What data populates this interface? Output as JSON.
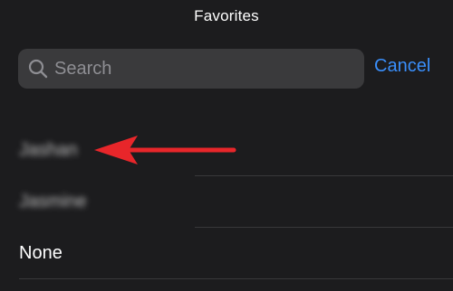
{
  "header": {
    "title": "Favorites"
  },
  "search": {
    "placeholder": "Search",
    "value": "",
    "cancel_label": "Cancel"
  },
  "list": {
    "items": [
      {
        "label": "Jashan",
        "blurred": true
      },
      {
        "label": "Jasmine",
        "blurred": true
      },
      {
        "label": "None",
        "blurred": false
      }
    ]
  },
  "annotation": {
    "arrow_color": "#e8262a"
  },
  "colors": {
    "background": "#1c1c1e",
    "search_field": "#3a3a3c",
    "accent": "#3a8ffb",
    "placeholder": "#8e8e93"
  },
  "icons": {
    "search": "magnifying-glass"
  }
}
